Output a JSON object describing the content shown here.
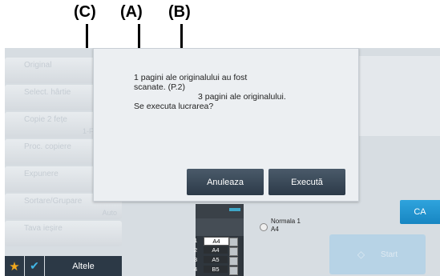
{
  "annotations": [
    "(C)",
    "(A)",
    "(B)"
  ],
  "sidebar": {
    "items": [
      {
        "label": "Original",
        "sub": ""
      },
      {
        "label": "Select. hârtie",
        "sub": ""
      },
      {
        "label": "Copie 2 fețe",
        "sub": "1-Fața→1-"
      },
      {
        "label": "Proc. copiere",
        "sub": ""
      },
      {
        "label": "Expunere",
        "sub": ""
      },
      {
        "label": "Sortare/Grupare",
        "sub": "Auto"
      },
      {
        "label": "Tava ieșire",
        "sub": ""
      }
    ],
    "others_label": "Altele"
  },
  "dialog": {
    "line1": "1 pagini ale originalului au fost",
    "line2": "scanate. (P.2)",
    "line3": "3 pagini ale originalului.",
    "line4": "Se executa lucrarea?",
    "cancel_label": "Anuleaza",
    "execute_label": "Execută"
  },
  "ca_label": "CA",
  "start_label": "Start",
  "output_tray": {
    "label": "Normala 1",
    "size": "A4"
  },
  "trays": [
    {
      "num": "1",
      "size": "A4",
      "selected": true
    },
    {
      "num": "2",
      "size": "A4",
      "selected": false
    },
    {
      "num": "3",
      "size": "A5",
      "selected": false
    },
    {
      "num": "4",
      "size": "B5",
      "selected": false
    }
  ]
}
